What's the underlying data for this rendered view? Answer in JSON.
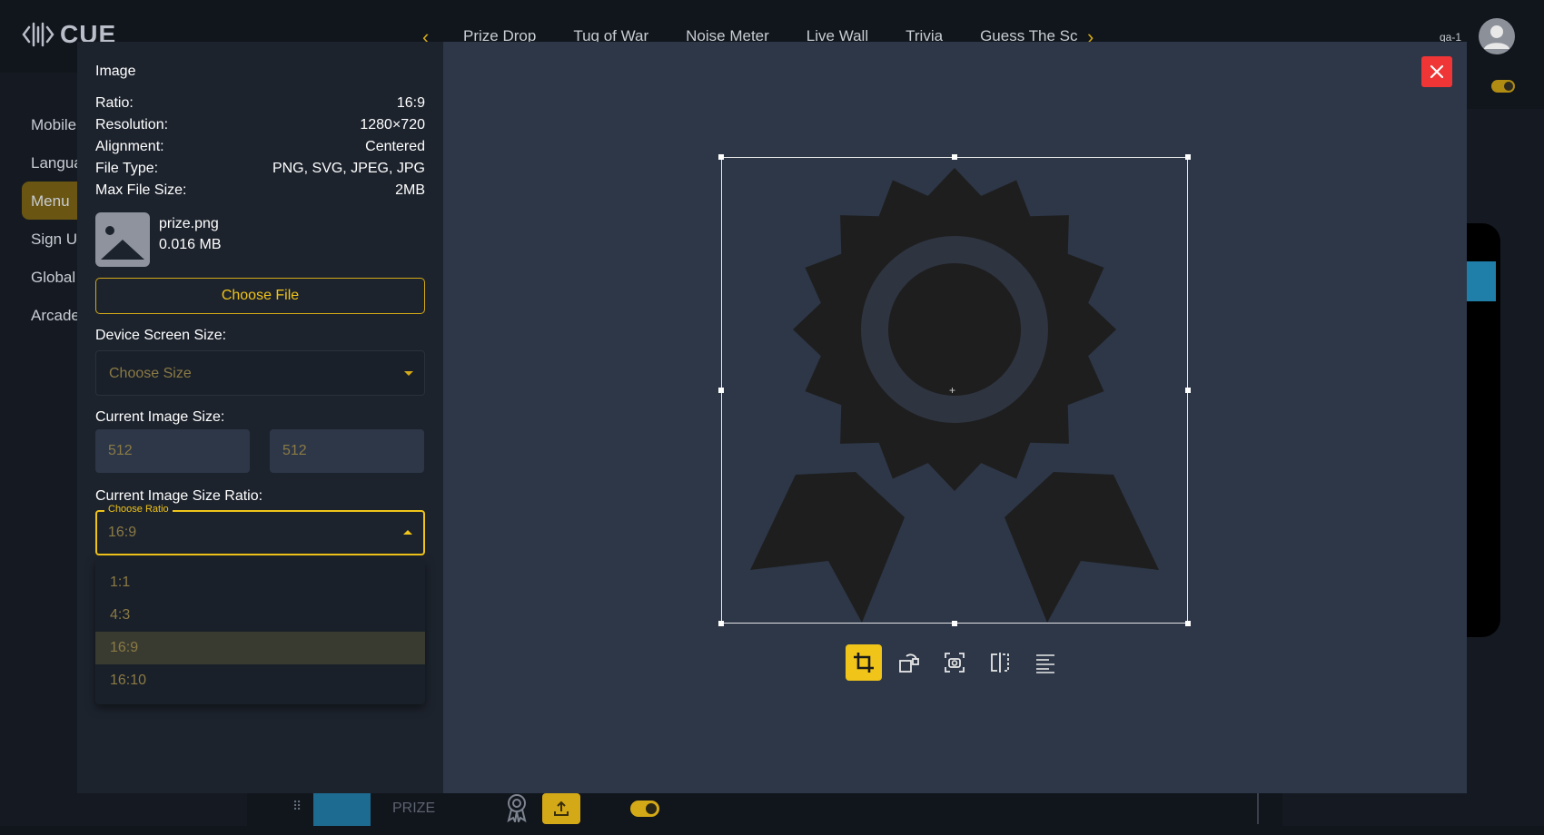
{
  "app": {
    "logo_text": "CUE",
    "nav_tabs": [
      "Prize Drop",
      "Tug of War",
      "Noise Meter",
      "Live Wall",
      "Trivia",
      "Guess The Sc"
    ],
    "user_name": "qa-1"
  },
  "sidebar": {
    "items": [
      "Mobile",
      "Langua",
      "Menu",
      "Sign U",
      "Global",
      "Arcade"
    ],
    "active": "Menu"
  },
  "bottom_bar": {
    "prize_label": "PRIZE"
  },
  "modal": {
    "title": "Image",
    "info": {
      "ratio_label": "Ratio:",
      "ratio_value": "16:9",
      "resolution_label": "Resolution:",
      "resolution_value": "1280×720",
      "alignment_label": "Alignment:",
      "alignment_value": "Centered",
      "filetype_label": "File Type:",
      "filetype_value": "PNG, SVG, JPEG, JPG",
      "maxsize_label": "Max File Size:",
      "maxsize_value": "2MB"
    },
    "file": {
      "name": "prize.png",
      "size": "0.016 MB"
    },
    "choose_file_label": "Choose File",
    "device_size": {
      "label": "Device Screen Size:",
      "placeholder": "Choose Size"
    },
    "current_size": {
      "label": "Current Image Size:",
      "width": "512",
      "height": "512"
    },
    "ratio_select": {
      "label": "Current Image Size Ratio:",
      "legend": "Choose Ratio",
      "value": "16:9",
      "options": [
        "1:1",
        "4:3",
        "16:9",
        "16:10"
      ],
      "selected_index": 2
    },
    "tools": [
      "crop-icon",
      "rotate-icon",
      "capture-icon",
      "flip-icon",
      "align-icon"
    ],
    "active_tool": "crop-icon"
  },
  "colors": {
    "accent": "#f0c419",
    "close": "#ef3535",
    "modal_bg": "#2d3748",
    "panel_bg": "#1d232d"
  }
}
